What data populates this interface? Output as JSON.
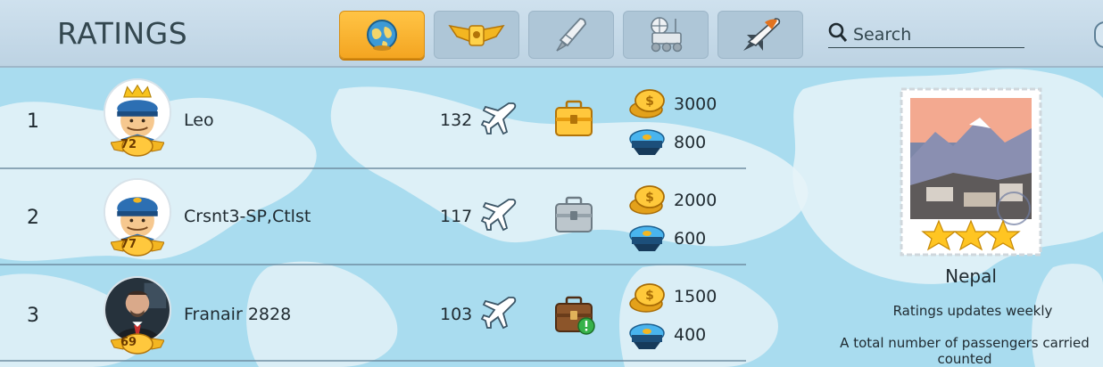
{
  "header": {
    "title": "RATINGS",
    "tabs": [
      {
        "icon": "globe-icon",
        "active": true
      },
      {
        "icon": "pilot-wings-icon",
        "active": false
      },
      {
        "icon": "rocket-icon",
        "active": false
      },
      {
        "icon": "lunar-rover-icon",
        "active": false
      },
      {
        "icon": "space-shuttle-icon",
        "active": false
      }
    ],
    "search": {
      "placeholder": "Search"
    }
  },
  "rows": [
    {
      "rank": "1",
      "name": "Leo",
      "level": "72",
      "passengers": "132",
      "case": "gold-briefcase-icon",
      "coins": "3000",
      "caps": "800"
    },
    {
      "rank": "2",
      "name": "Crsnt3-SP,Ctlst",
      "level": "77",
      "passengers": "117",
      "case": "silver-briefcase-icon",
      "coins": "2000",
      "caps": "600"
    },
    {
      "rank": "3",
      "name": "Franair 2828",
      "level": "69",
      "passengers": "103",
      "case": "bronze-briefcase-icon",
      "coins": "1500",
      "caps": "400"
    }
  ],
  "panel": {
    "country": "Nepal",
    "stars": 3,
    "note_weekly": "Ratings updates weekly",
    "note_total": "A total number of passengers carried counted"
  },
  "colors": {
    "header_bg": "#c5d9e8",
    "active_tab": "#f9b534",
    "map_sea": "#a9dcef",
    "map_land": "#e3f1f7"
  }
}
